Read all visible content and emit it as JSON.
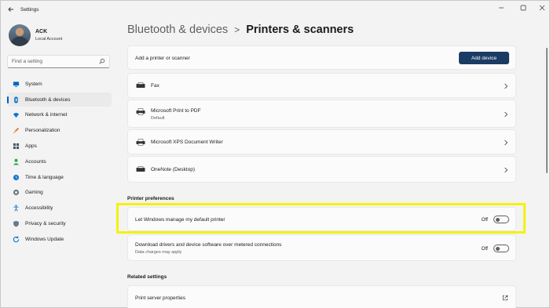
{
  "window": {
    "title": "Settings"
  },
  "user": {
    "name": "ACK",
    "account_type": "Local Account"
  },
  "search": {
    "placeholder": "Find a setting"
  },
  "nav": [
    {
      "label": "System",
      "icon": "monitor-icon",
      "color": "#0067c0"
    },
    {
      "label": "Bluetooth & devices",
      "icon": "bluetooth-icon",
      "color": "#0067c0",
      "active": true
    },
    {
      "label": "Network & internet",
      "icon": "wifi-icon",
      "color": "#0a74d4"
    },
    {
      "label": "Personalization",
      "icon": "brush-icon",
      "color": "#e0793a"
    },
    {
      "label": "Apps",
      "icon": "apps-icon",
      "color": "#4d5a69"
    },
    {
      "label": "Accounts",
      "icon": "person-icon",
      "color": "#2ea34a"
    },
    {
      "label": "Time & language",
      "icon": "globe-clock-icon",
      "color": "#1a73d6"
    },
    {
      "label": "Gaming",
      "icon": "controller-icon",
      "color": "#6b7a89"
    },
    {
      "label": "Accessibility",
      "icon": "accessibility-icon",
      "color": "#1a73d6"
    },
    {
      "label": "Privacy & security",
      "icon": "shield-icon",
      "color": "#6b7a89"
    },
    {
      "label": "Windows Update",
      "icon": "update-icon",
      "color": "#1a73d6"
    }
  ],
  "header": {
    "parent": "Bluetooth & devices",
    "separator": ">",
    "current": "Printers & scanners"
  },
  "add_printer": {
    "label": "Add a printer or scanner",
    "button": "Add device"
  },
  "printers": [
    {
      "name": "Fax",
      "status": ""
    },
    {
      "name": "Microsoft Print to PDF",
      "status": "Default"
    },
    {
      "name": "Microsoft XPS Document Writer",
      "status": ""
    },
    {
      "name": "OneNote (Desktop)",
      "status": ""
    }
  ],
  "preferences": {
    "title": "Printer preferences",
    "manage_default": {
      "label": "Let Windows manage my default printer",
      "state": "Off"
    },
    "metered": {
      "label": "Download drivers and device software over metered connections",
      "sub": "Data charges may apply",
      "state": "Off"
    }
  },
  "related": {
    "title": "Related settings",
    "print_server": "Print server properties"
  },
  "colors": {
    "accent": "#005fb8",
    "button": "#1a3b64",
    "highlight": "#f5f20b"
  }
}
